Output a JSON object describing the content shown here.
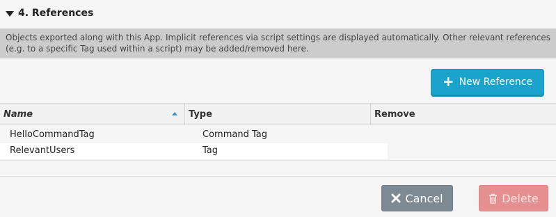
{
  "section": {
    "title": "4. References"
  },
  "info": {
    "text": "Objects exported along with this App. Implicit references via script settings are displayed automatically. Other relevant references (e.g. to a specific Tag used within a script) may be added/removed here."
  },
  "toolbar": {
    "new_reference_label": "New Reference"
  },
  "table": {
    "columns": {
      "name": "Name",
      "type": "Type",
      "remove": "Remove"
    },
    "sort": {
      "column": "Name",
      "direction": "ascending"
    },
    "rows": [
      {
        "name": "HelloCommandTag",
        "type": "Command Tag"
      },
      {
        "name": "RelevantUsers",
        "type": "Tag"
      }
    ]
  },
  "footer": {
    "cancel_label": "Cancel",
    "delete_label": "Delete"
  },
  "colors": {
    "primary": "#1aa3cc",
    "cancel": "#7d8a93",
    "delete": "#e58f91",
    "sort_icon": "#3a8fd0"
  },
  "icons": {
    "collapse": "triangle-down-icon",
    "new": "plus-icon",
    "sort": "sort-asc-icon",
    "cancel": "close-x-icon",
    "delete": "trash-icon"
  }
}
